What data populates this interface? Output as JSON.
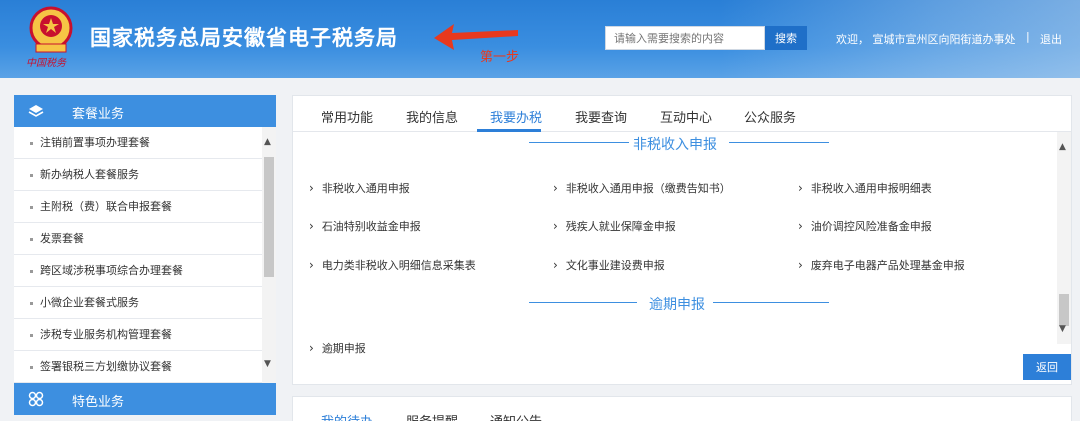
{
  "header": {
    "emblem_caption": "中国税务",
    "title": "国家税务总局安徽省电子税务局",
    "annotation": "第一步",
    "search_placeholder": "请输入需要搜索的内容",
    "search_button": "搜索",
    "welcome": "欢迎，  宣城市宣州区向阳街道办事处",
    "separator": "|",
    "logout": "退出"
  },
  "sidebar": {
    "section1": "套餐业务",
    "items": [
      "注销前置事项办理套餐",
      "新办纳税人套餐服务",
      "主附税（费）联合申报套餐",
      "发票套餐",
      "跨区域涉税事项综合办理套餐",
      "小微企业套餐式服务",
      "涉税专业服务机构管理套餐",
      "签署银税三方划缴协议套餐"
    ],
    "section2": "特色业务"
  },
  "main": {
    "tabs": [
      "常用功能",
      "我的信息",
      "我要办税",
      "我要查询",
      "互动中心",
      "公众服务"
    ],
    "active_tab": "我要办税",
    "section1_title": "非税收入申报",
    "section1_links": [
      "非税收入通用申报",
      "非税收入通用申报（缴费告知书）",
      "非税收入通用申报明细表",
      "石油特别收益金申报",
      "残疾人就业保障金申报",
      "油价调控风险准备金申报",
      "电力类非税收入明细信息采集表",
      "文化事业建设费申报",
      "废弃电子电器产品处理基金申报"
    ],
    "section2_title": "逾期申报",
    "section2_links": [
      "逾期申报"
    ],
    "back_button": "返回"
  },
  "bottom": {
    "tabs": [
      "我的待办",
      "服务提醒",
      "通知公告"
    ]
  },
  "colors": {
    "header_blue": "#3a8ee0",
    "accent_blue": "#2d7fd8",
    "annotation_red": "#e8391e"
  }
}
